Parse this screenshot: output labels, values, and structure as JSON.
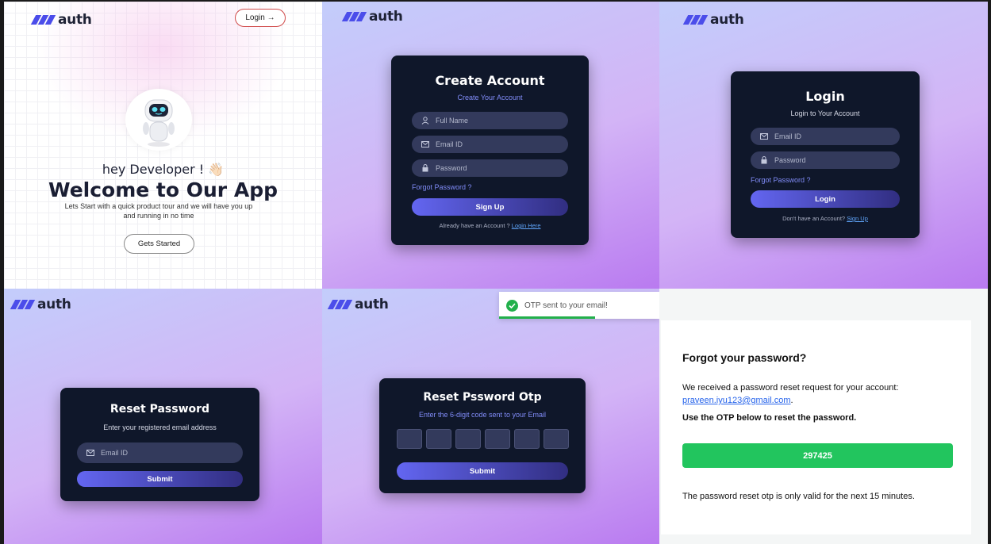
{
  "brand": {
    "name": "auth",
    "accent": "#4b4dea"
  },
  "landing": {
    "login_button": "Login →",
    "greeting": "hey Developer ! 👋🏻",
    "headline": "Welcome to Our App",
    "subtitle": "Lets Start with a quick product tour and we will have you up and running in no time",
    "cta": "Gets Started"
  },
  "signup": {
    "title": "Create Account",
    "caption": "Create Your Account",
    "fields": {
      "name": "Full Name",
      "email": "Email ID",
      "password": "Password"
    },
    "forgot": "Forgot Password ?",
    "submit": "Sign Up",
    "footer_text": "Already have an Account ? ",
    "footer_link": "Login Here"
  },
  "login": {
    "title": "Login",
    "caption": "Login to Your Account",
    "fields": {
      "email": "Email ID",
      "password": "Password"
    },
    "forgot": "Forgot Password ?",
    "submit": "Login",
    "footer_text": "Don't have an Account? ",
    "footer_link": "Sign Up"
  },
  "reset": {
    "title": "Reset Password",
    "caption": "Enter your registered email address",
    "email_placeholder": "Email ID",
    "submit": "Submit"
  },
  "reset_otp": {
    "title": "Reset Pssword Otp",
    "caption": "Enter the 6-digit code sent to your Email",
    "submit": "Submit",
    "toast": "OTP sent to your email!",
    "toast_progress": 0.6,
    "toast_color": "#22b04b"
  },
  "email": {
    "heading": "Forgot your password?",
    "intro": "We received a password reset request for your account:",
    "address": "praveen.iyu123@gmail.com",
    "instruction": "Use the OTP below to reset the password.",
    "otp_code": "297425",
    "otp_color": "#22c55e",
    "validity": "The password reset otp is only valid for the next 15 minutes."
  }
}
